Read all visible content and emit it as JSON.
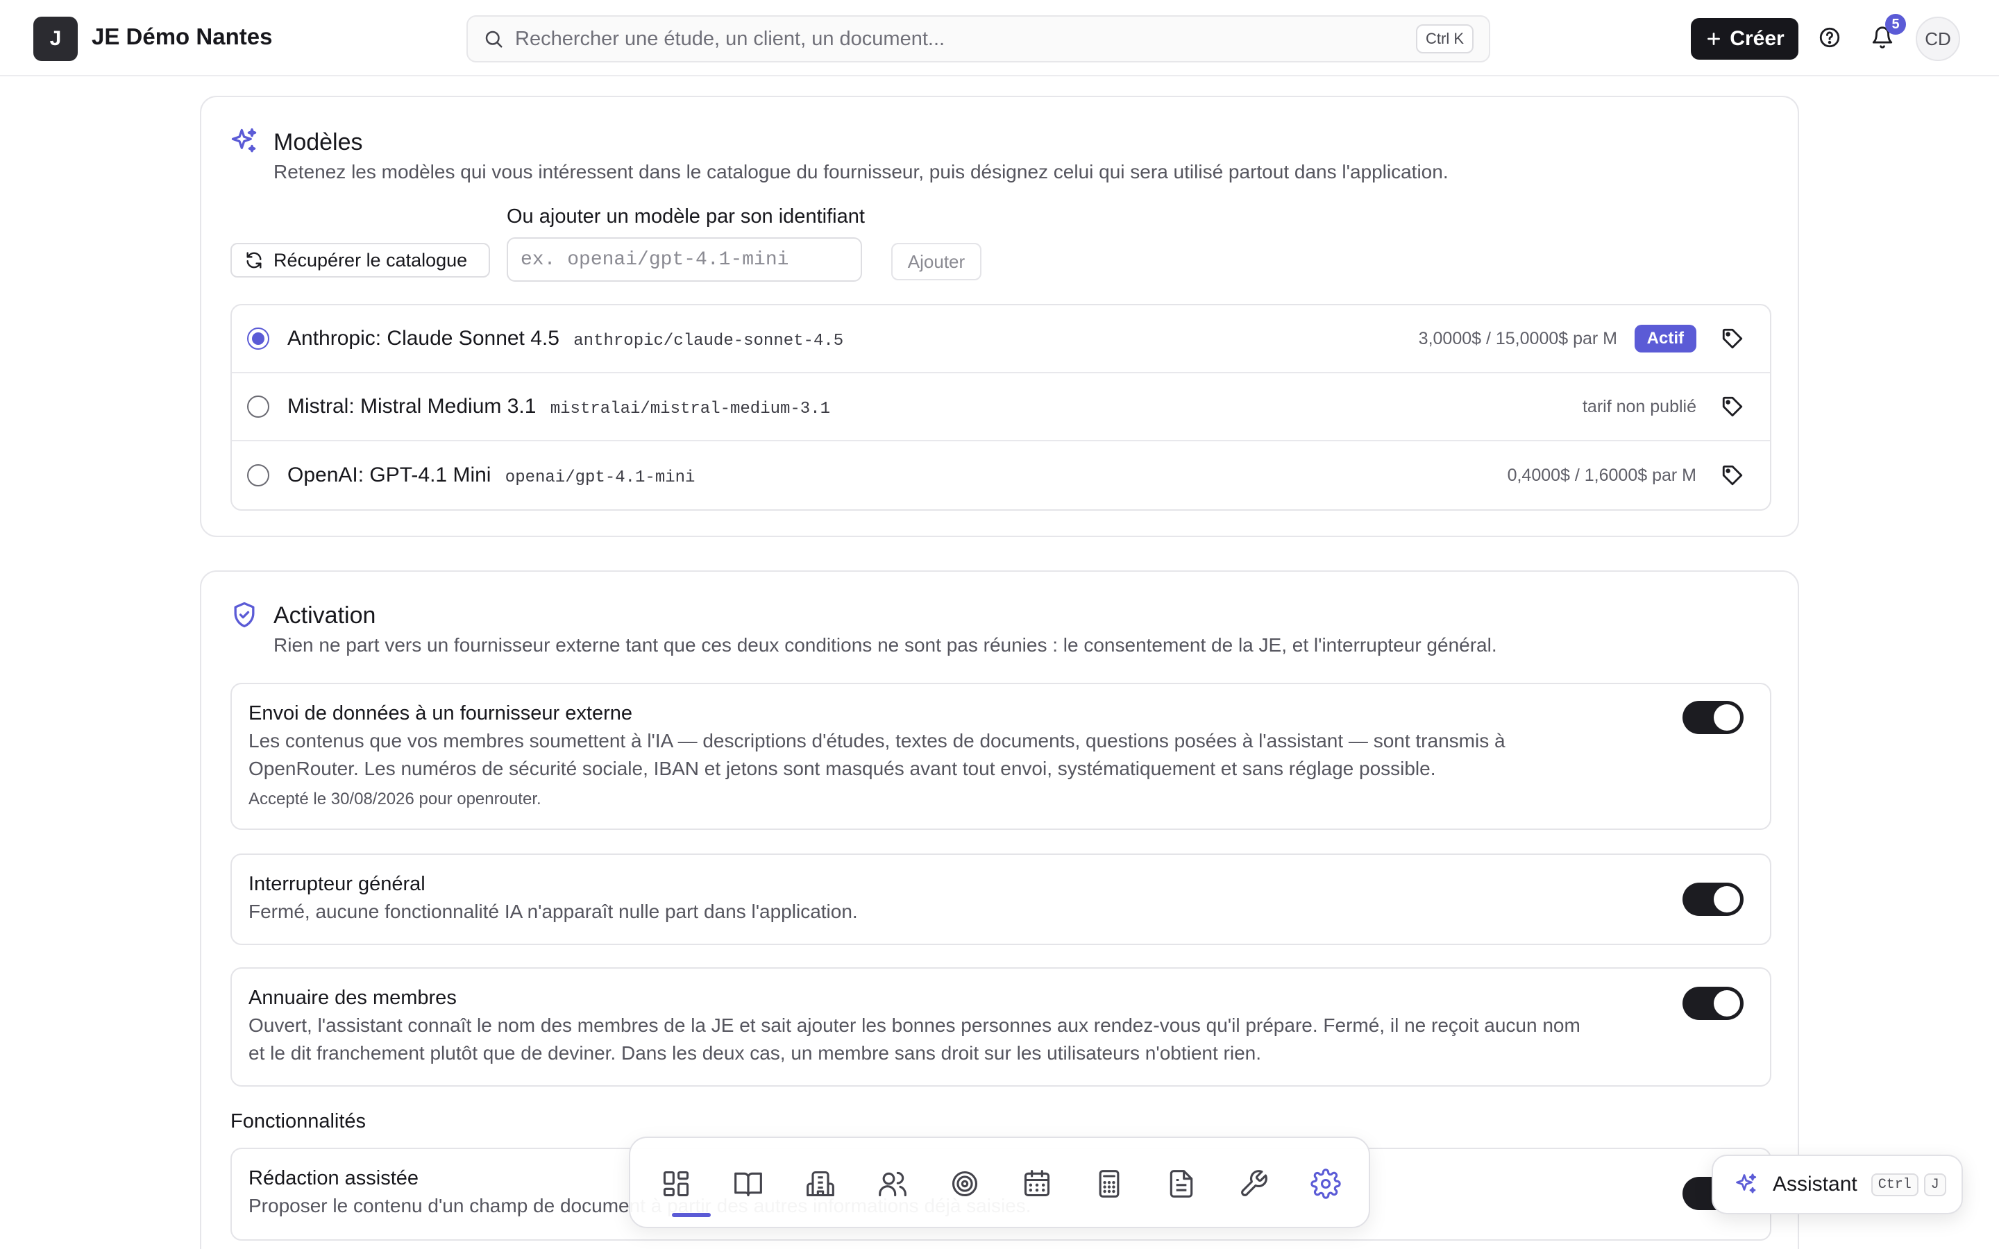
{
  "app": {
    "org_initial": "J",
    "org_name": "JE Démo Nantes"
  },
  "search": {
    "placeholder": "Rechercher une étude, un client, un document...",
    "shortcut": "Ctrl K"
  },
  "header": {
    "create_label": "Créer",
    "notification_count": "5",
    "avatar_initials": "CD",
    "icons": [
      "search-icon",
      "plus-icon",
      "help-icon",
      "bell-icon"
    ]
  },
  "models": {
    "title": "Modèles",
    "description": "Retenez les modèles qui vous intéressent dans le catalogue du fournisseur, puis désignez celui qui sera utilisé partout dans l'application.",
    "add_label": "Ou ajouter un modèle par son identifiant",
    "fetch_label": "Récupérer le catalogue",
    "input_placeholder": "ex. openai/gpt-4.1-mini",
    "add_button": "Ajouter",
    "items": [
      {
        "name": "Anthropic: Claude Sonnet 4.5",
        "id": "anthropic/claude-sonnet-4.5",
        "price": "3,0000$ / 15,0000$ par M",
        "badge": "Actif",
        "selected": true
      },
      {
        "name": "Mistral: Mistral Medium 3.1",
        "id": "mistralai/mistral-medium-3.1",
        "price": "tarif non publié",
        "selected": false
      },
      {
        "name": "OpenAI: GPT-4.1 Mini",
        "id": "openai/gpt-4.1-mini",
        "price": "0,4000$ / 1,6000$ par M",
        "selected": false
      }
    ]
  },
  "activation": {
    "title": "Activation",
    "description": "Rien ne part vers un fournisseur externe tant que ces deux conditions ne sont pas réunies : le consentement de la JE, et l'interrupteur général.",
    "consent": {
      "title": "Envoi de données à un fournisseur externe",
      "line1": "Les contenus que vos membres soumettent à l'IA — descriptions d'études, textes de documents, questions posées à l'assistant — sont transmis à",
      "line2": "OpenRouter. Les numéros de sécurité sociale, IBAN et jetons sont masqués avant tout envoi, systématiquement et sans réglage possible.",
      "note": "Accepté le 30/08/2026 pour openrouter.",
      "on": true
    },
    "master": {
      "title": "Interrupteur général",
      "desc": "Fermé, aucune fonctionnalité IA n'apparaît nulle part dans l'application.",
      "on": true
    },
    "directory": {
      "title": "Annuaire des membres",
      "line1": "Ouvert, l'assistant connaît le nom des membres de la JE et sait ajouter les bonnes personnes aux rendez-vous qu'il prépare. Fermé, il ne reçoit aucun nom",
      "line2": "et le dit franchement plutôt que de deviner. Dans les deux cas, un membre sans droit sur les utilisateurs n'obtient rien.",
      "on": true
    },
    "features_label": "Fonctionnalités",
    "assisted_writing": {
      "title": "Rédaction assistée",
      "desc": "Proposer le contenu d'un champ de document à partir des autres informations déjà saisies.",
      "on": true
    }
  },
  "dock": {
    "items": [
      "dashboard-icon",
      "book-icon",
      "building-icon",
      "users-icon",
      "target-icon",
      "calendar-icon",
      "calculator-icon",
      "document-icon",
      "wrench-icon",
      "settings-icon"
    ],
    "active": "settings-icon"
  },
  "assistant": {
    "label": "Assistant",
    "key1": "Ctrl",
    "key2": "J"
  },
  "colors": {
    "accent": "#5b5bd6",
    "dark": "#17171c",
    "border": "#e4e4e8"
  }
}
